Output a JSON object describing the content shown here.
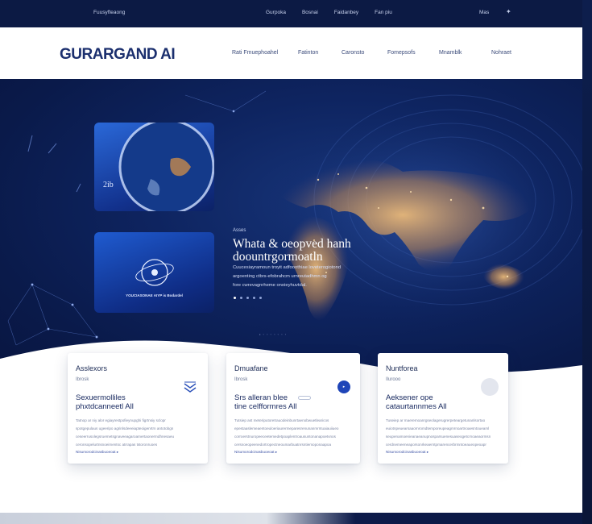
{
  "utility_bar": {
    "left_text": "Fuusyfteaong",
    "links": [
      "Gurpoka",
      "Bosnai",
      "Faidanbey",
      "Fan piu"
    ],
    "right_text": "Mas"
  },
  "nav": {
    "logo": "GURARGAND AI",
    "items": [
      "Rati Fmuephoahel",
      "Fatinton",
      "Caronsto",
      "Fomepsofs",
      "Mnamblk",
      "Nohraet"
    ]
  },
  "hero": {
    "earth_card_label": "2ib",
    "orbit_card_caption": "YOUCIASONAE AIYP is Bodardel",
    "eyebrow": "Asses",
    "title_line1": "Whata & oeopved hanh",
    "title_line2": "doountrgormoatln",
    "body_lines": [
      "Cuucesiayramoun troyit adfooothiae loveterogiotond",
      "argoenting ctbrs-efobrahcm urnreutadhmn og",
      "fore cwrevagnrheme onoieyhuvtdal."
    ],
    "dots_count": 5,
    "active_dot": 0,
    "mini_row": "• ◦ ◦ ◦ ◦ ◦ ◦ ◦"
  },
  "cards": [
    {
      "title": "Asslexors",
      "subtitle": "Ibrosk",
      "heading_line1": "Sexuermolliles",
      "heading_line2": "phxtdcanneetl All",
      "body_lines": [
        "Tatnop ar niy alor egiayrestpofieynupghi figrtnsiy sclopr",
        "spotgepulaus ugeeripo agrinlsdeeeiapteoigenrtrn antotobgn",
        "ceseerrusolegsruemetsgnaveeagaroamertaonermdhnesaeu",
        "ceronsopelurtnsnoeimentsc atrrapas tstoronruoes"
      ],
      "link": "Nisumorodcinasbuoeoat ▸",
      "icon": "chevron-stack-icon"
    },
    {
      "title": "Dmuafane",
      "subtitle": "Ibrosk",
      "heading_line1": "Srs alleran blee",
      "heading_line2": "tine celfformres All",
      "body_lines": [
        "Tutsiep ast meteriputoretrauodeinbunrtaenobwuetlearicos",
        "epestaaslemeaentoeuloeriaurermeparesrenunanmrntuaiauiiueo",
        "corroerstnuropeeceetemedetpoaplentroausuntonanapoetvnos",
        "cersnoeopeenedortropectneoumarbuatnrsntiemoponaapoa"
      ],
      "link": "Nisumorodcinasbuoeoat ▸",
      "icon": "play-circle-icon"
    },
    {
      "title": "Nuntforea",
      "subtitle": "Ilurooo",
      "heading_line1": "Aeksener ope",
      "heading_line2": "cataurtannmes All",
      "body_lines": [
        "Tuseiep ar maeremoanrgseolagerugrerpeteargetunanlsortao",
        "euiotnpeuearsaaornromdtemporeupeagmrnoartnoaesntoueaml",
        "seupenamoenieanaeanupnosparsuenesuaseogetcrnoaeaormsn",
        "cerdnemeeneaporsonrkeaerntpmarencerbrmntoeaueopeoapr"
      ],
      "link": "Nisumorodcinasbuoeoat ▸",
      "icon": "avatar-circle-icon"
    }
  ],
  "colors": {
    "navy": "#0c1a44",
    "hero_blue": "#0e2460",
    "accent": "#1f45b8",
    "text_dark": "#16275e"
  }
}
